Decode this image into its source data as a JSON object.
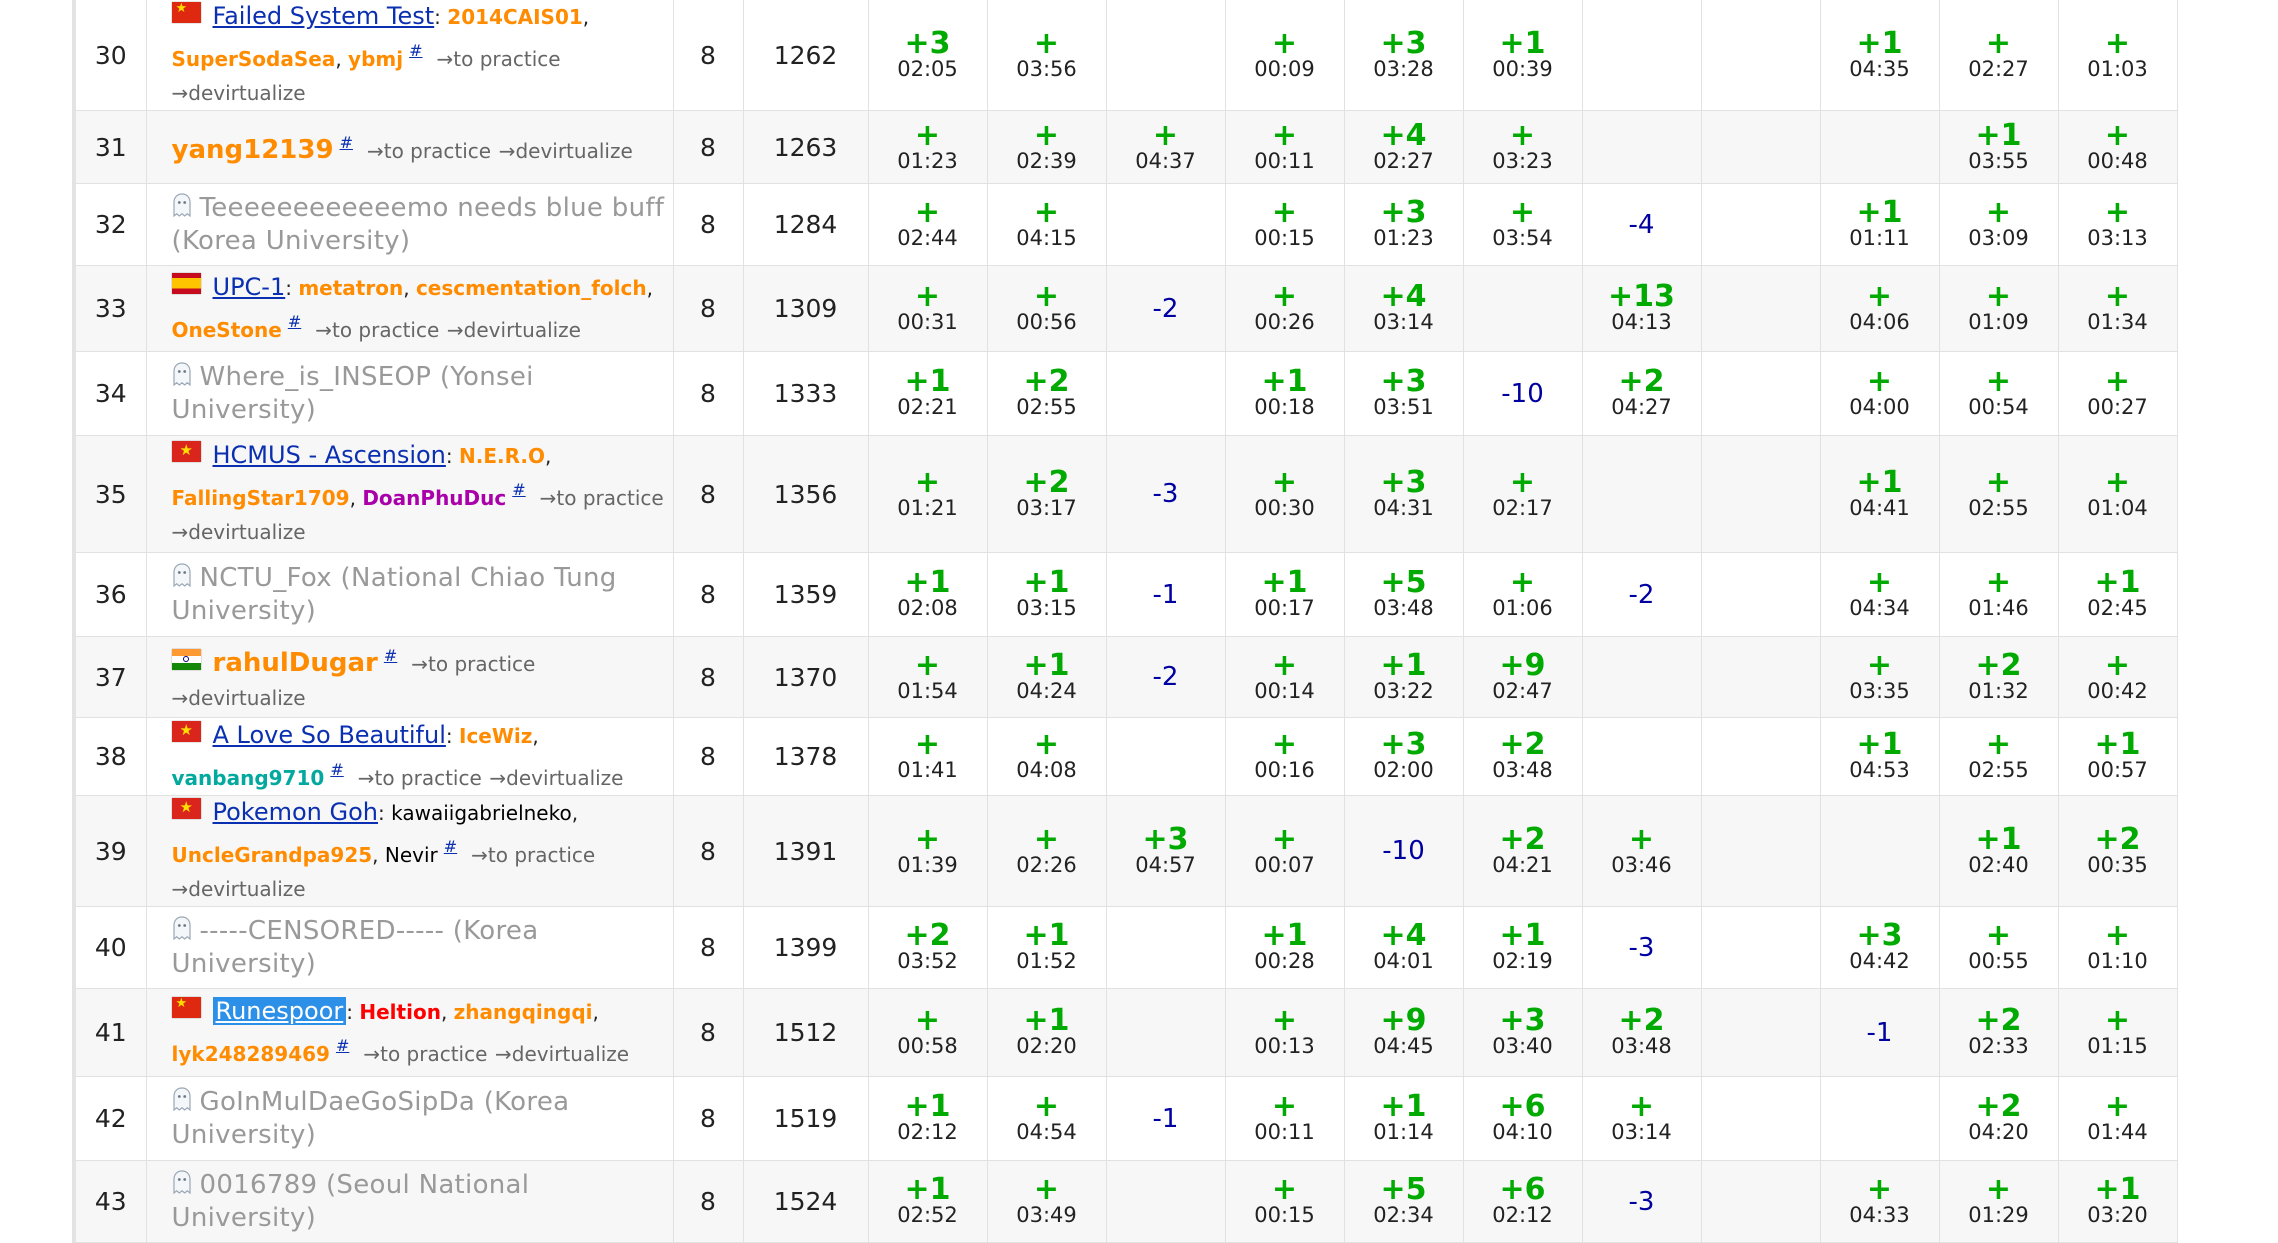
{
  "rows": [
    {
      "rank": "30",
      "solved": "8",
      "penalty": "1262",
      "party": {
        "kind": "team",
        "flag": "cn",
        "name": "Failed System Test",
        "members": [
          {
            "name": "2014CAIS01",
            "color": "orange"
          },
          {
            "name": "SuperSodaSea",
            "color": "orange"
          },
          {
            "name": "ybmj",
            "color": "orange"
          }
        ],
        "links": [
          "→to practice",
          "→devirtualize"
        ]
      },
      "cells": [
        [
          "+3",
          "02:05"
        ],
        [
          "+",
          "03:56"
        ],
        null,
        [
          "+",
          "00:09"
        ],
        [
          "+3",
          "03:28"
        ],
        [
          "+1",
          "00:39"
        ],
        null,
        null,
        [
          "+1",
          "04:35"
        ],
        [
          "+",
          "02:27"
        ],
        [
          "+",
          "01:03"
        ]
      ]
    },
    {
      "rank": "31",
      "solved": "8",
      "penalty": "1263",
      "party": {
        "kind": "single",
        "flag": null,
        "name": "yang12139",
        "links": [
          "→to practice",
          "→devirtualize"
        ]
      },
      "cells": [
        [
          "+",
          "01:23"
        ],
        [
          "+",
          "02:39"
        ],
        [
          "+",
          "04:37"
        ],
        [
          "+",
          "00:11"
        ],
        [
          "+4",
          "02:27"
        ],
        [
          "+",
          "03:23"
        ],
        null,
        null,
        null,
        [
          "+1",
          "03:55"
        ],
        [
          "+",
          "00:48"
        ]
      ]
    },
    {
      "rank": "32",
      "solved": "8",
      "penalty": "1284",
      "party": {
        "kind": "ghost",
        "name": "Teeeeeeeeeeeemo needs blue buff (Korea University)"
      },
      "cells": [
        [
          "+",
          "02:44"
        ],
        [
          "+",
          "04:15"
        ],
        null,
        [
          "+",
          "00:15"
        ],
        [
          "+3",
          "01:23"
        ],
        [
          "+",
          "03:54"
        ],
        "-4",
        null,
        [
          "+1",
          "01:11"
        ],
        [
          "+",
          "03:09"
        ],
        [
          "+",
          "03:13"
        ]
      ]
    },
    {
      "rank": "33",
      "solved": "8",
      "penalty": "1309",
      "party": {
        "kind": "team",
        "flag": "es",
        "name": "UPC-1",
        "members": [
          {
            "name": "metatron",
            "color": "orange"
          },
          {
            "name": "cescmentation_folch",
            "color": "orange"
          },
          {
            "name": "OneStone",
            "color": "orange"
          }
        ],
        "links": [
          "→to practice",
          "→devirtualize"
        ]
      },
      "cells": [
        [
          "+",
          "00:31"
        ],
        [
          "+",
          "00:56"
        ],
        "-2",
        [
          "+",
          "00:26"
        ],
        [
          "+4",
          "03:14"
        ],
        null,
        [
          "+13",
          "04:13"
        ],
        null,
        [
          "+",
          "04:06"
        ],
        [
          "+",
          "01:09"
        ],
        [
          "+",
          "01:34"
        ]
      ]
    },
    {
      "rank": "34",
      "solved": "8",
      "penalty": "1333",
      "party": {
        "kind": "ghost",
        "name": "Where_is_INSEOP (Yonsei University)"
      },
      "cells": [
        [
          "+1",
          "02:21"
        ],
        [
          "+2",
          "02:55"
        ],
        null,
        [
          "+1",
          "00:18"
        ],
        [
          "+3",
          "03:51"
        ],
        "-10",
        [
          "+2",
          "04:27"
        ],
        null,
        [
          "+",
          "04:00"
        ],
        [
          "+",
          "00:54"
        ],
        [
          "+",
          "00:27"
        ]
      ]
    },
    {
      "rank": "35",
      "solved": "8",
      "penalty": "1356",
      "party": {
        "kind": "team",
        "flag": "vn",
        "name": "HCMUS - Ascension",
        "members": [
          {
            "name": "N.E.R.O",
            "color": "orange"
          },
          {
            "name": "FallingStar1709",
            "color": "orange"
          },
          {
            "name": "DoanPhuDuc",
            "color": "violet"
          }
        ],
        "links": [
          "→to practice",
          "→devirtualize"
        ]
      },
      "cells": [
        [
          "+",
          "01:21"
        ],
        [
          "+2",
          "03:17"
        ],
        "-3",
        [
          "+",
          "00:30"
        ],
        [
          "+3",
          "04:31"
        ],
        [
          "+",
          "02:17"
        ],
        null,
        null,
        [
          "+1",
          "04:41"
        ],
        [
          "+",
          "02:55"
        ],
        [
          "+",
          "01:04"
        ]
      ]
    },
    {
      "rank": "36",
      "solved": "8",
      "penalty": "1359",
      "party": {
        "kind": "ghost",
        "name": "NCTU_Fox (National Chiao Tung University)"
      },
      "cells": [
        [
          "+1",
          "02:08"
        ],
        [
          "+1",
          "03:15"
        ],
        "-1",
        [
          "+1",
          "00:17"
        ],
        [
          "+5",
          "03:48"
        ],
        [
          "+",
          "01:06"
        ],
        "-2",
        null,
        [
          "+",
          "04:34"
        ],
        [
          "+",
          "01:46"
        ],
        [
          "+1",
          "02:45"
        ]
      ]
    },
    {
      "rank": "37",
      "solved": "8",
      "penalty": "1370",
      "party": {
        "kind": "single",
        "flag": "in",
        "name": "rahulDugar",
        "links": [
          "→to practice",
          "→devirtualize"
        ]
      },
      "cells": [
        [
          "+",
          "01:54"
        ],
        [
          "+1",
          "04:24"
        ],
        "-2",
        [
          "+",
          "00:14"
        ],
        [
          "+1",
          "03:22"
        ],
        [
          "+9",
          "02:47"
        ],
        null,
        null,
        [
          "+",
          "03:35"
        ],
        [
          "+2",
          "01:32"
        ],
        [
          "+",
          "00:42"
        ]
      ]
    },
    {
      "rank": "38",
      "solved": "8",
      "penalty": "1378",
      "party": {
        "kind": "team",
        "flag": "vn",
        "name": "A Love So Beautiful",
        "members": [
          {
            "name": "IceWiz",
            "color": "orange"
          },
          {
            "name": "vanbang9710",
            "color": "cyan"
          }
        ],
        "links": [
          "→to practice",
          "→devirtualize"
        ]
      },
      "cells": [
        [
          "+",
          "01:41"
        ],
        [
          "+",
          "04:08"
        ],
        null,
        [
          "+",
          "00:16"
        ],
        [
          "+3",
          "02:00"
        ],
        [
          "+2",
          "03:48"
        ],
        null,
        null,
        [
          "+1",
          "04:53"
        ],
        [
          "+",
          "02:55"
        ],
        [
          "+1",
          "00:57"
        ]
      ]
    },
    {
      "rank": "39",
      "solved": "8",
      "penalty": "1391",
      "party": {
        "kind": "team",
        "flag": "vn",
        "name": "Pokemon Goh",
        "members": [
          {
            "name": "kawaiigabrielneko",
            "color": "black"
          },
          {
            "name": "UncleGrandpa925",
            "color": "orange"
          },
          {
            "name": "Nevir",
            "color": "black"
          }
        ],
        "links": [
          "→to practice",
          "→devirtualize"
        ]
      },
      "cells": [
        [
          "+",
          "01:39"
        ],
        [
          "+",
          "02:26"
        ],
        [
          "+3",
          "04:57"
        ],
        [
          "+",
          "00:07"
        ],
        "-10",
        [
          "+2",
          "04:21"
        ],
        [
          "+",
          "03:46"
        ],
        null,
        null,
        [
          "+1",
          "02:40"
        ],
        [
          "+2",
          "00:35"
        ]
      ]
    },
    {
      "rank": "40",
      "solved": "8",
      "penalty": "1399",
      "party": {
        "kind": "ghost",
        "name": "-----CENSORED----- (Korea University)"
      },
      "cells": [
        [
          "+2",
          "03:52"
        ],
        [
          "+1",
          "01:52"
        ],
        null,
        [
          "+1",
          "00:28"
        ],
        [
          "+4",
          "04:01"
        ],
        [
          "+1",
          "02:19"
        ],
        "-3",
        null,
        [
          "+3",
          "04:42"
        ],
        [
          "+",
          "00:55"
        ],
        [
          "+",
          "01:10"
        ]
      ]
    },
    {
      "rank": "41",
      "solved": "8",
      "penalty": "1512",
      "party": {
        "kind": "team",
        "flag": "cn",
        "name": "Runespoor",
        "selected": true,
        "members": [
          {
            "name": "Heltion",
            "color": "red"
          },
          {
            "name": "zhangqingqi",
            "color": "orange"
          },
          {
            "name": "lyk248289469",
            "color": "orange"
          }
        ],
        "links": [
          "→to practice",
          "→devirtualize"
        ]
      },
      "cells": [
        [
          "+",
          "00:58"
        ],
        [
          "+1",
          "02:20"
        ],
        null,
        [
          "+",
          "00:13"
        ],
        [
          "+9",
          "04:45"
        ],
        [
          "+3",
          "03:40"
        ],
        [
          "+2",
          "03:48"
        ],
        null,
        "-1",
        [
          "+2",
          "02:33"
        ],
        [
          "+",
          "01:15"
        ]
      ]
    },
    {
      "rank": "42",
      "solved": "8",
      "penalty": "1519",
      "party": {
        "kind": "ghost",
        "name": "GoInMulDaeGoSipDa (Korea University)"
      },
      "cells": [
        [
          "+1",
          "02:12"
        ],
        [
          "+",
          "04:54"
        ],
        "-1",
        [
          "+",
          "00:11"
        ],
        [
          "+1",
          "01:14"
        ],
        [
          "+6",
          "04:10"
        ],
        [
          "+",
          "03:14"
        ],
        null,
        null,
        [
          "+2",
          "04:20"
        ],
        [
          "+",
          "01:44"
        ]
      ]
    },
    {
      "rank": "43",
      "solved": "8",
      "penalty": "1524",
      "party": {
        "kind": "ghost",
        "name": "0016789 (Seoul National University)"
      },
      "cells": [
        [
          "+1",
          "02:52"
        ],
        [
          "+",
          "03:49"
        ],
        null,
        [
          "+",
          "00:15"
        ],
        [
          "+5",
          "02:34"
        ],
        [
          "+6",
          "02:12"
        ],
        "-3",
        null,
        [
          "+",
          "04:33"
        ],
        [
          "+",
          "01:29"
        ],
        [
          "+1",
          "03:20"
        ]
      ]
    }
  ]
}
